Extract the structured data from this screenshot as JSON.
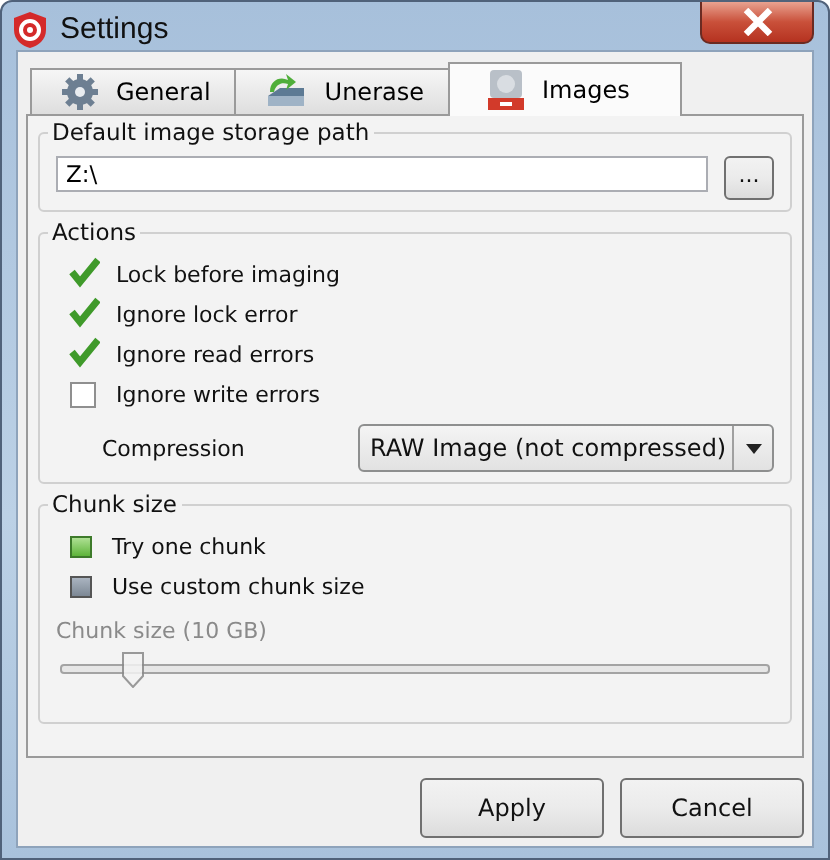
{
  "window": {
    "title": "Settings"
  },
  "tabs": [
    {
      "label": "General",
      "kind": "gear",
      "selected": false
    },
    {
      "label": "Unerase",
      "kind": "disk",
      "selected": false
    },
    {
      "label": "Images",
      "kind": "image",
      "selected": true
    }
  ],
  "path_group": {
    "title": "Default image storage path",
    "value": "Z:\\",
    "browse": "..."
  },
  "actions": {
    "title": "Actions",
    "options": [
      {
        "label": "Lock before imaging",
        "checked": true
      },
      {
        "label": "Ignore lock error",
        "checked": true
      },
      {
        "label": "Ignore read errors",
        "checked": true
      },
      {
        "label": "Ignore write errors",
        "checked": false
      }
    ],
    "compression": {
      "label": "Compression",
      "value": "RAW Image (not compressed)"
    }
  },
  "chunk": {
    "title": "Chunk size",
    "choices": [
      {
        "label": "Try one chunk",
        "selected": true
      },
      {
        "label": "Use custom chunk size",
        "selected": false
      }
    ],
    "slider": {
      "label": "Chunk size (10 GB)",
      "disabled": true,
      "level": 0.1
    }
  },
  "buttons": [
    "Apply",
    "Cancel"
  ]
}
